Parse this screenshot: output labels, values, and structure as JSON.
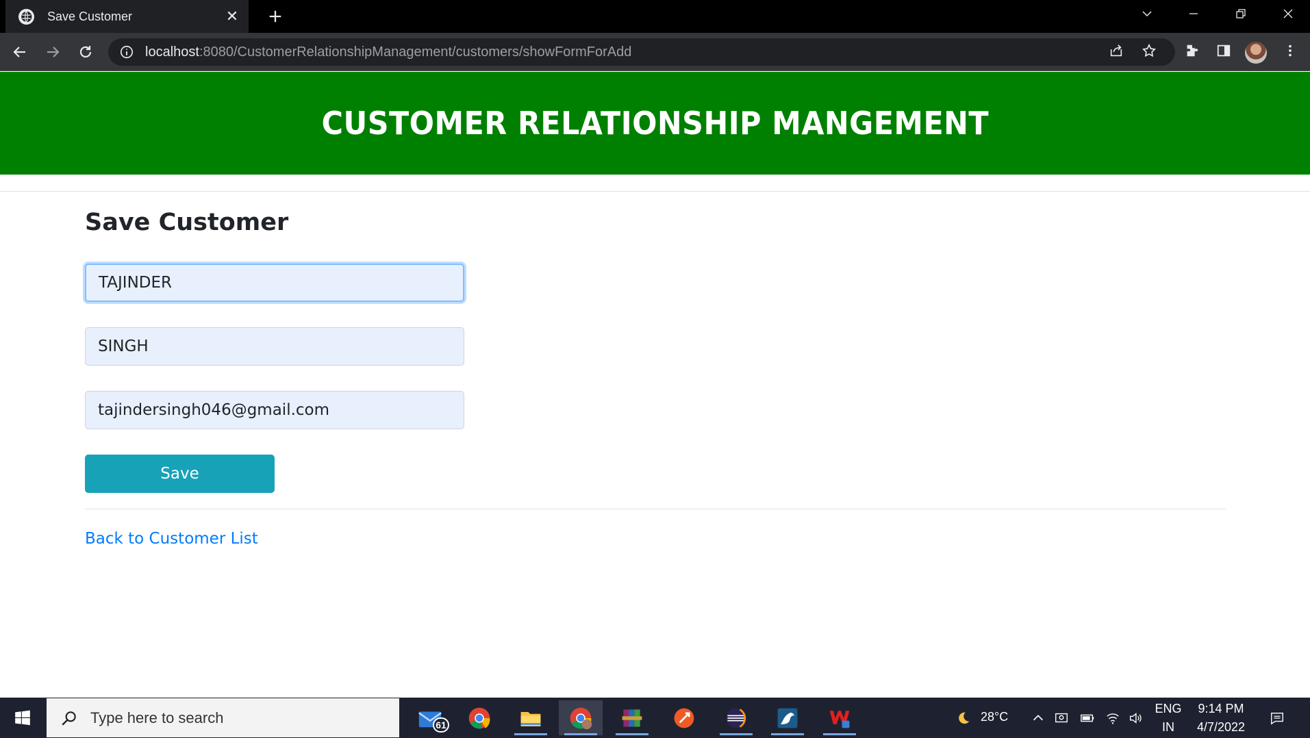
{
  "browser": {
    "tab_title": "Save Customer",
    "url_host": "localhost",
    "url_rest": ":8080/CustomerRelationshipManagement/customers/showFormForAdd"
  },
  "page": {
    "banner_title": "CUSTOMER RELATIONSHIP MANGEMENT",
    "form_title": "Save Customer",
    "first_name_value": "TAJINDER",
    "last_name_value": "SINGH",
    "email_value": "tajindersingh046@gmail.com",
    "save_label": "Save",
    "back_link_label": "Back to Customer List"
  },
  "colors": {
    "banner": "#008000",
    "save_button": "#17a2b8",
    "link": "#007bff",
    "autofill_field": "#e8f0fe"
  },
  "taskbar": {
    "search_placeholder": "Type here to search",
    "mail_badge": "61",
    "weather_temp": "28°C",
    "language_line1": "ENG",
    "language_line2": "IN",
    "time": "9:14 PM",
    "date": "4/7/2022",
    "apps": [
      "mail-icon",
      "chrome-icon",
      "file-explorer-icon",
      "chrome-profile-icon",
      "winrar-icon",
      "postman-icon",
      "eclipse-icon",
      "mysql-workbench-icon",
      "wps-office-icon"
    ]
  }
}
